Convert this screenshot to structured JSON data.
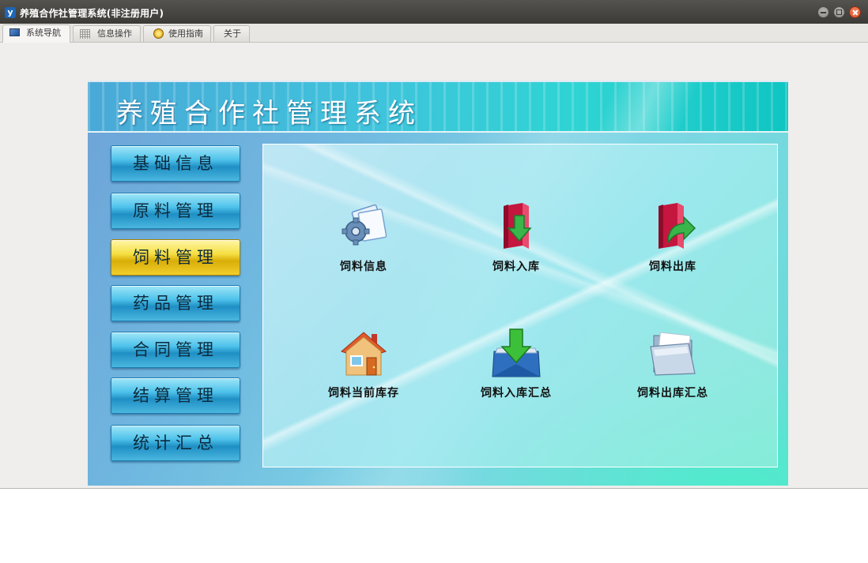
{
  "window": {
    "title": "养殖合作社管理系统(非注册用户)",
    "logo_letter": "y"
  },
  "tabs": [
    {
      "label": "系统导航",
      "icon": "monitor-icon",
      "active": true
    },
    {
      "label": "信息操作",
      "icon": "grid-icon",
      "active": false
    },
    {
      "label": "使用指南",
      "icon": "help-icon",
      "active": false
    },
    {
      "label": "关于",
      "icon": "",
      "active": false
    }
  ],
  "header": {
    "title": "养殖合作社管理系统"
  },
  "sidebar": {
    "items": [
      {
        "label": "基础信息",
        "active": false
      },
      {
        "label": "原料管理",
        "active": false
      },
      {
        "label": "饲料管理",
        "active": true
      },
      {
        "label": "药品管理",
        "active": false
      },
      {
        "label": "合同管理",
        "active": false
      },
      {
        "label": "结算管理",
        "active": false
      },
      {
        "label": "统计汇总",
        "active": false
      }
    ]
  },
  "functions": [
    {
      "label": "饲料信息",
      "icon": "gear-document-icon"
    },
    {
      "label": "饲料入库",
      "icon": "book-arrow-down-icon"
    },
    {
      "label": "饲料出库",
      "icon": "book-arrow-out-icon"
    },
    {
      "label": "饲料当前库存",
      "icon": "house-icon"
    },
    {
      "label": "饲料入库汇总",
      "icon": "tray-download-icon"
    },
    {
      "label": "饲料出库汇总",
      "icon": "folder-icon"
    }
  ],
  "colors": {
    "titlebar": "#3b3a37",
    "active_button": "#f5df43",
    "button": "#4dc1ea"
  }
}
